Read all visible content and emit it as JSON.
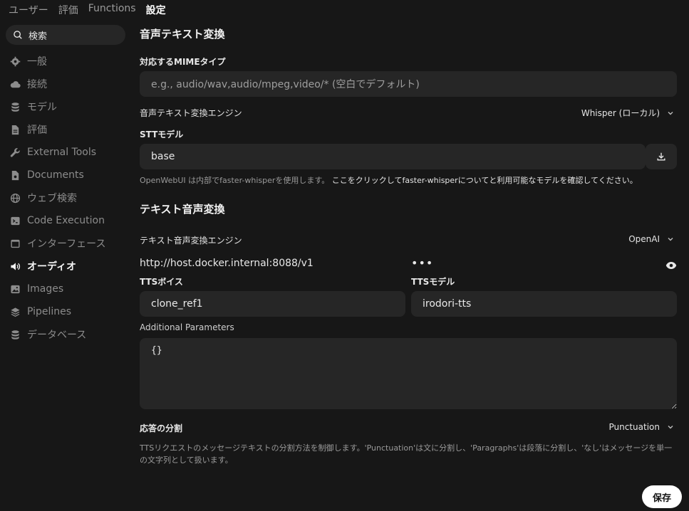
{
  "topnav": {
    "items": [
      {
        "label": "ユーザー"
      },
      {
        "label": "評価"
      },
      {
        "label": "Functions"
      },
      {
        "label": "設定"
      }
    ]
  },
  "search": {
    "placeholder": "検索"
  },
  "sidebar": {
    "items": [
      {
        "label": "一般",
        "icon": "gear-icon"
      },
      {
        "label": "接続",
        "icon": "cloud-icon"
      },
      {
        "label": "モデル",
        "icon": "database-icon"
      },
      {
        "label": "評価",
        "icon": "document-icon"
      },
      {
        "label": "External Tools",
        "icon": "wrench-icon"
      },
      {
        "label": "Documents",
        "icon": "document-text-icon"
      },
      {
        "label": "ウェブ検索",
        "icon": "globe-icon"
      },
      {
        "label": "Code Execution",
        "icon": "terminal-icon"
      },
      {
        "label": "インターフェース",
        "icon": "window-icon"
      },
      {
        "label": "オーディオ",
        "icon": "speaker-icon",
        "active": true
      },
      {
        "label": "Images",
        "icon": "image-icon"
      },
      {
        "label": "Pipelines",
        "icon": "layers-icon"
      },
      {
        "label": "データベース",
        "icon": "database-icon"
      }
    ]
  },
  "stt": {
    "title": "音声テキスト変換",
    "mime_label": "対応するMIMEタイプ",
    "mime_placeholder": "e.g., audio/wav,audio/mpeg,video/* (空白でデフォルト)",
    "engine_label": "音声テキスト変換エンジン",
    "engine_value": "Whisper (ローカル)",
    "model_label": "STTモデル",
    "model_value": "base",
    "note_text": "OpenWebUI は内部でfaster-whisperを使用します。",
    "note_link": "ここをクリックしてfaster-whisperについてと利用可能なモデルを確認してください。"
  },
  "tts": {
    "title": "テキスト音声変換",
    "engine_label": "テキスト音声変換エンジン",
    "engine_value": "OpenAI",
    "api_url": "http://host.docker.internal:8088/v1",
    "api_key_masked": "•••",
    "voice_label": "TTSボイス",
    "voice_value": "clone_ref1",
    "model_label": "TTSモデル",
    "model_value": "irodori-tts",
    "params_label": "Additional Parameters",
    "params_value": "{}",
    "split_label": "応答の分割",
    "split_value": "Punctuation",
    "split_note": "TTSリクエストのメッセージテキストの分割方法を制御します。'Punctuation'は文に分割し、'Paragraphs'は段落に分割し、'なし'はメッセージを単一の文字列として扱います。"
  },
  "save_label": "保存"
}
